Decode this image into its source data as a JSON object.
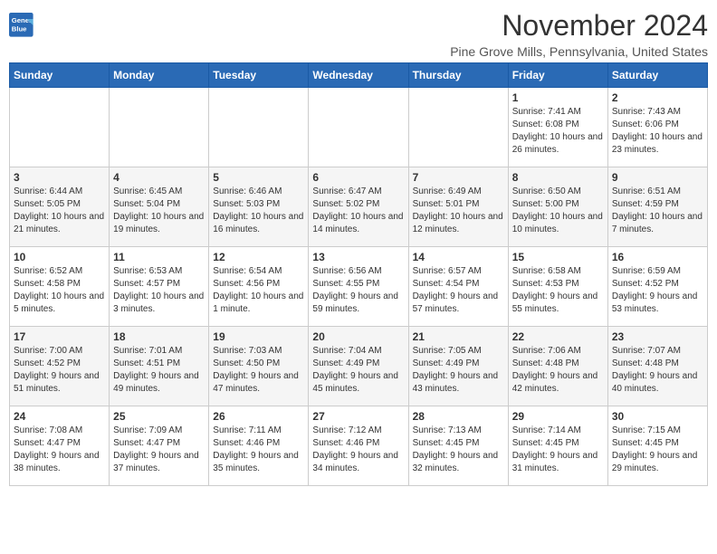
{
  "logo": {
    "line1": "General",
    "line2": "Blue"
  },
  "title": "November 2024",
  "subtitle": "Pine Grove Mills, Pennsylvania, United States",
  "weekdays": [
    "Sunday",
    "Monday",
    "Tuesday",
    "Wednesday",
    "Thursday",
    "Friday",
    "Saturday"
  ],
  "weeks": [
    [
      {
        "day": "",
        "info": ""
      },
      {
        "day": "",
        "info": ""
      },
      {
        "day": "",
        "info": ""
      },
      {
        "day": "",
        "info": ""
      },
      {
        "day": "",
        "info": ""
      },
      {
        "day": "1",
        "info": "Sunrise: 7:41 AM\nSunset: 6:08 PM\nDaylight: 10 hours and 26 minutes."
      },
      {
        "day": "2",
        "info": "Sunrise: 7:43 AM\nSunset: 6:06 PM\nDaylight: 10 hours and 23 minutes."
      }
    ],
    [
      {
        "day": "3",
        "info": "Sunrise: 6:44 AM\nSunset: 5:05 PM\nDaylight: 10 hours and 21 minutes."
      },
      {
        "day": "4",
        "info": "Sunrise: 6:45 AM\nSunset: 5:04 PM\nDaylight: 10 hours and 19 minutes."
      },
      {
        "day": "5",
        "info": "Sunrise: 6:46 AM\nSunset: 5:03 PM\nDaylight: 10 hours and 16 minutes."
      },
      {
        "day": "6",
        "info": "Sunrise: 6:47 AM\nSunset: 5:02 PM\nDaylight: 10 hours and 14 minutes."
      },
      {
        "day": "7",
        "info": "Sunrise: 6:49 AM\nSunset: 5:01 PM\nDaylight: 10 hours and 12 minutes."
      },
      {
        "day": "8",
        "info": "Sunrise: 6:50 AM\nSunset: 5:00 PM\nDaylight: 10 hours and 10 minutes."
      },
      {
        "day": "9",
        "info": "Sunrise: 6:51 AM\nSunset: 4:59 PM\nDaylight: 10 hours and 7 minutes."
      }
    ],
    [
      {
        "day": "10",
        "info": "Sunrise: 6:52 AM\nSunset: 4:58 PM\nDaylight: 10 hours and 5 minutes."
      },
      {
        "day": "11",
        "info": "Sunrise: 6:53 AM\nSunset: 4:57 PM\nDaylight: 10 hours and 3 minutes."
      },
      {
        "day": "12",
        "info": "Sunrise: 6:54 AM\nSunset: 4:56 PM\nDaylight: 10 hours and 1 minute."
      },
      {
        "day": "13",
        "info": "Sunrise: 6:56 AM\nSunset: 4:55 PM\nDaylight: 9 hours and 59 minutes."
      },
      {
        "day": "14",
        "info": "Sunrise: 6:57 AM\nSunset: 4:54 PM\nDaylight: 9 hours and 57 minutes."
      },
      {
        "day": "15",
        "info": "Sunrise: 6:58 AM\nSunset: 4:53 PM\nDaylight: 9 hours and 55 minutes."
      },
      {
        "day": "16",
        "info": "Sunrise: 6:59 AM\nSunset: 4:52 PM\nDaylight: 9 hours and 53 minutes."
      }
    ],
    [
      {
        "day": "17",
        "info": "Sunrise: 7:00 AM\nSunset: 4:52 PM\nDaylight: 9 hours and 51 minutes."
      },
      {
        "day": "18",
        "info": "Sunrise: 7:01 AM\nSunset: 4:51 PM\nDaylight: 9 hours and 49 minutes."
      },
      {
        "day": "19",
        "info": "Sunrise: 7:03 AM\nSunset: 4:50 PM\nDaylight: 9 hours and 47 minutes."
      },
      {
        "day": "20",
        "info": "Sunrise: 7:04 AM\nSunset: 4:49 PM\nDaylight: 9 hours and 45 minutes."
      },
      {
        "day": "21",
        "info": "Sunrise: 7:05 AM\nSunset: 4:49 PM\nDaylight: 9 hours and 43 minutes."
      },
      {
        "day": "22",
        "info": "Sunrise: 7:06 AM\nSunset: 4:48 PM\nDaylight: 9 hours and 42 minutes."
      },
      {
        "day": "23",
        "info": "Sunrise: 7:07 AM\nSunset: 4:48 PM\nDaylight: 9 hours and 40 minutes."
      }
    ],
    [
      {
        "day": "24",
        "info": "Sunrise: 7:08 AM\nSunset: 4:47 PM\nDaylight: 9 hours and 38 minutes."
      },
      {
        "day": "25",
        "info": "Sunrise: 7:09 AM\nSunset: 4:47 PM\nDaylight: 9 hours and 37 minutes."
      },
      {
        "day": "26",
        "info": "Sunrise: 7:11 AM\nSunset: 4:46 PM\nDaylight: 9 hours and 35 minutes."
      },
      {
        "day": "27",
        "info": "Sunrise: 7:12 AM\nSunset: 4:46 PM\nDaylight: 9 hours and 34 minutes."
      },
      {
        "day": "28",
        "info": "Sunrise: 7:13 AM\nSunset: 4:45 PM\nDaylight: 9 hours and 32 minutes."
      },
      {
        "day": "29",
        "info": "Sunrise: 7:14 AM\nSunset: 4:45 PM\nDaylight: 9 hours and 31 minutes."
      },
      {
        "day": "30",
        "info": "Sunrise: 7:15 AM\nSunset: 4:45 PM\nDaylight: 9 hours and 29 minutes."
      }
    ]
  ]
}
